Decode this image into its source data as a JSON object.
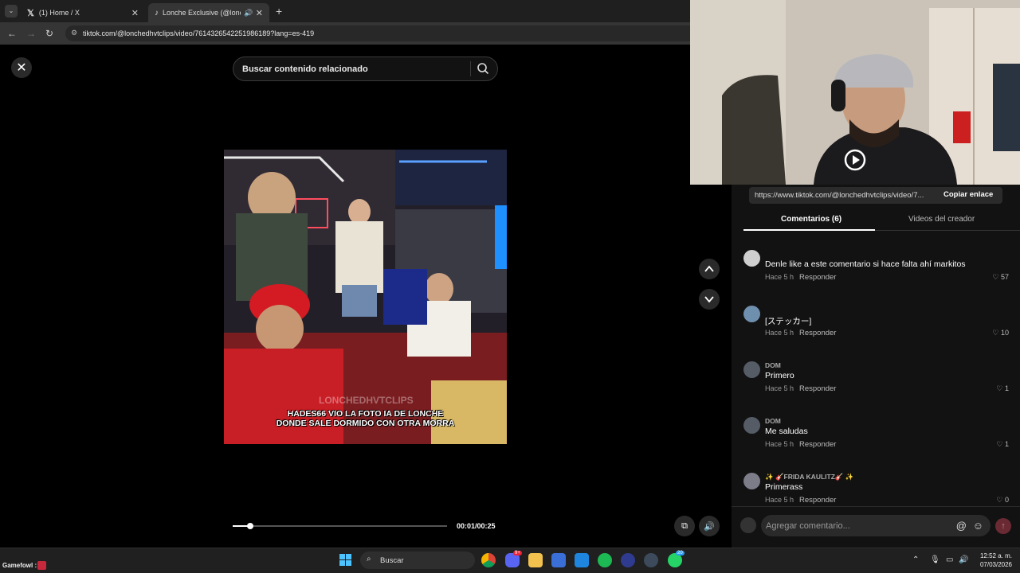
{
  "browser": {
    "tabs": [
      {
        "title": "(1) Home / X",
        "icon": "x-logo-icon"
      },
      {
        "title": "Lonche Exclusive (@lonchec",
        "icon": "tiktok-logo-icon"
      }
    ],
    "url": "tiktok.com/@lonchedhvtclips/video/7614326542251986189?lang=es-419"
  },
  "player": {
    "search_placeholder": "Buscar contenido relacionado",
    "caption_line1": "HADES66 VIO LA FOTO IA DE LONCHE",
    "caption_line2": "DONDE SALE DORMIDO CON OTRA MORRA",
    "watermark": "LONCHEDHVTCLIPS",
    "time": "00:01/00:25",
    "progress": 0.08
  },
  "panel": {
    "share_url": "https://www.tiktok.com/@lonchedhvtclips/video/7...",
    "copy_link": "Copiar enlace",
    "tabs": [
      "Comentarios (6)",
      "Videos del creador"
    ],
    "comments": [
      {
        "name": "",
        "text": "Denle like a este comentario si hace falta ahí markitos",
        "time": "Hace 5 h",
        "reply": "Responder",
        "likes": "57",
        "avatar_color": "#cfcfcf"
      },
      {
        "name": "",
        "text": "[ステッカー]",
        "time": "Hace 5 h",
        "reply": "Responder",
        "likes": "10",
        "avatar_color": "#6f8fae"
      },
      {
        "name": "DOM",
        "text": "Primero",
        "time": "Hace 5 h",
        "reply": "Responder",
        "likes": "1",
        "avatar_color": "#555c66"
      },
      {
        "name": "DOM",
        "text": "Me saludas",
        "time": "Hace 5 h",
        "reply": "Responder",
        "likes": "1",
        "avatar_color": "#555c66"
      },
      {
        "name": "✨ 🎸FRIDA KAULITZ🎸 ✨",
        "text": "Primerass",
        "time": "Hace 5 h",
        "reply": "Responder",
        "likes": "0",
        "avatar_color": "#7d7d8a"
      }
    ],
    "comment_placeholder": "Agregar comentario..."
  },
  "taskbar": {
    "left_label": "Gamefowl :",
    "search_label": "Buscar",
    "time": "12:52 a. m.",
    "date": "07/03/2026",
    "badges": [
      "9+",
      "20"
    ]
  },
  "colors": {
    "accent_red": "#fe2c55",
    "panel_bg": "#121212"
  }
}
